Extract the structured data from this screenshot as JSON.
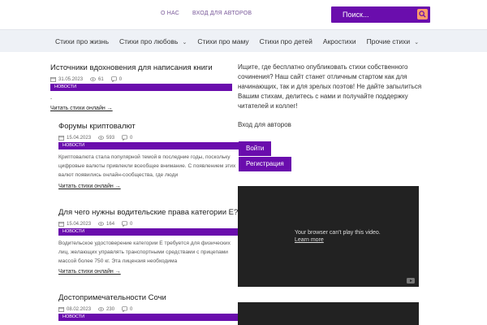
{
  "header": {
    "links": [
      "О НАС",
      "ВХОД ДЛЯ АВТОРОВ"
    ],
    "search_placeholder": "Поиск...",
    "accent": "#6a0dad",
    "search_button_color": "#ff9b6a"
  },
  "nav": {
    "items": [
      "Стихи про жизнь",
      "Стихи про любовь",
      "Стихи про маму",
      "Стихи про детей",
      "Акростихи",
      "Прочие стихи"
    ],
    "dropdown_indices": [
      1,
      5
    ]
  },
  "articles": [
    {
      "title": "Источники вдохновения для написания книги",
      "date": "31.05.2023",
      "views": "61",
      "comments": "0",
      "badge": "НОВОСТИ",
      "excerpt": "-",
      "read_more": "Читать стихи онлайн →"
    },
    {
      "title": "Форумы криптовалют",
      "date": "15.04.2023",
      "views": "593",
      "comments": "0",
      "badge": "НОВОСТИ",
      "excerpt": "Криптовалюта стала популярной темой в последние годы, поскольку цифровые валюты привлекли всеобщее внимание. С появлением этих валют появились онлайн-сообщества, где люди",
      "read_more": "Читать стихи онлайн →"
    },
    {
      "title": "Для чего нужны водительские права категории Е?",
      "date": "15.04.2023",
      "views": "164",
      "comments": "0",
      "badge": "НОВОСТИ",
      "excerpt": "Водительское удостоверение категории Е требуется для физических лиц, желающих управлять транспортными средствами с прицепами массой более 750 кг. Эта лицензия необходима",
      "read_more": "Читать стихи онлайн →"
    },
    {
      "title": "Достопримечательности Сочи",
      "date": "08.02.2023",
      "views": "230",
      "comments": "0",
      "badge": "НОВОСТИ"
    }
  ],
  "sidebar": {
    "intro": "Ищите, где бесплатно опубликовать стихи собственного сочинения? Наш сайт станет отличным стартом как для начинающих, так и для зрелых поэтов! Не дайте запылиться Вашим стихам, делитесь с нами и получайте поддержку читателей и коллег!",
    "login_heading": "Вход для авторов",
    "login_button": "Войти",
    "register_button": "Регистрация",
    "video_message": "Your browser can't play this video.",
    "video_link": "Learn more"
  }
}
